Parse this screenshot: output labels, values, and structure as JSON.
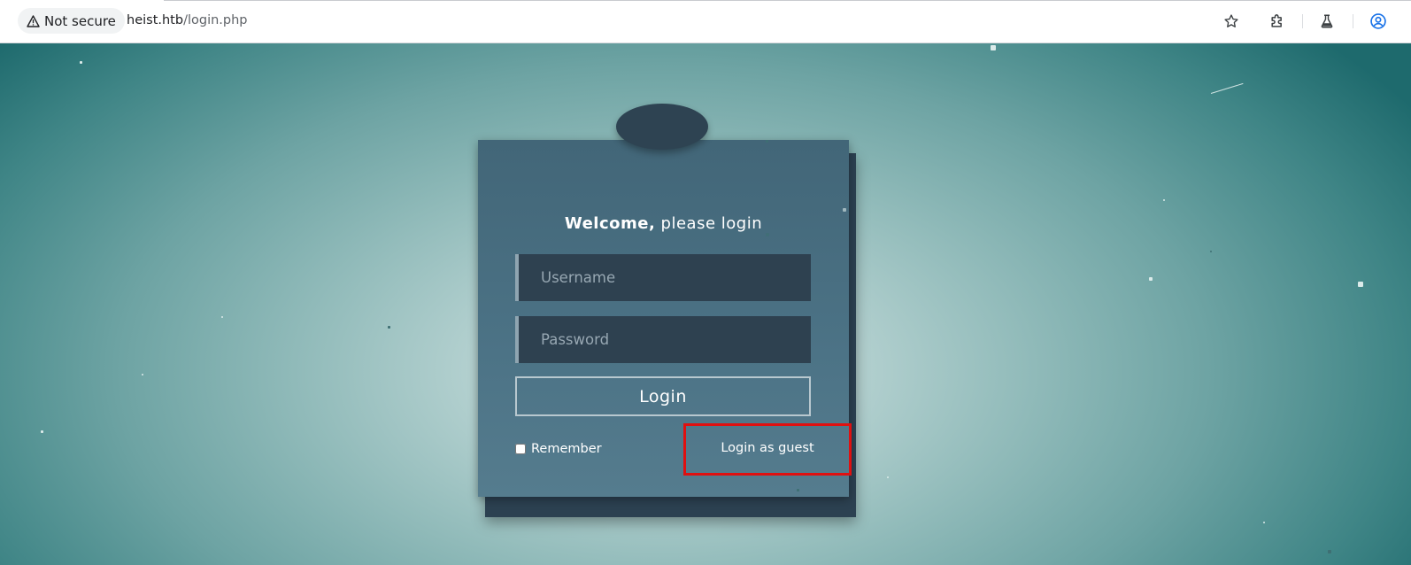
{
  "browser": {
    "security_label": "Not secure",
    "url_host": "heist.htb",
    "url_path": "/login.php"
  },
  "login": {
    "welcome_bold": "Welcome,",
    "welcome_rest": " please login",
    "username_placeholder": "Username",
    "password_placeholder": "Password",
    "login_button": "Login",
    "remember_label": "Remember",
    "guest_link": "Login as guest"
  },
  "colors": {
    "card": "#4c7386",
    "input_bg": "#2e4150",
    "highlight_box": "#e01010"
  }
}
